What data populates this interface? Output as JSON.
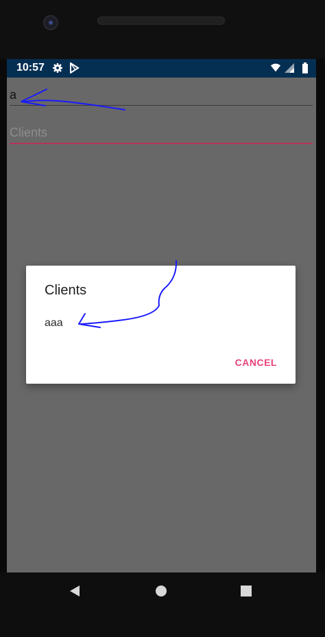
{
  "status_bar": {
    "time": "10:57",
    "icons": [
      "gear-icon",
      "play-store-icon",
      "wifi-icon",
      "signal-icon",
      "battery-icon"
    ],
    "background": "#052f52"
  },
  "form": {
    "field1_value": "a",
    "field2_placeholder": "Clients",
    "field2_underline_color": "#b8335a"
  },
  "dialog": {
    "title": "Clients",
    "items": [
      "aaa"
    ],
    "cancel_label": "CANCEL",
    "accent_color": "#e8417a"
  },
  "nav_bar": {
    "buttons": [
      "back-icon",
      "home-icon",
      "recents-icon"
    ]
  },
  "annotations": {
    "color": "#1a1aff",
    "shapes": [
      "hand-drawn-arrow-to-field1",
      "hand-drawn-arrow-to-dialog-item"
    ]
  }
}
